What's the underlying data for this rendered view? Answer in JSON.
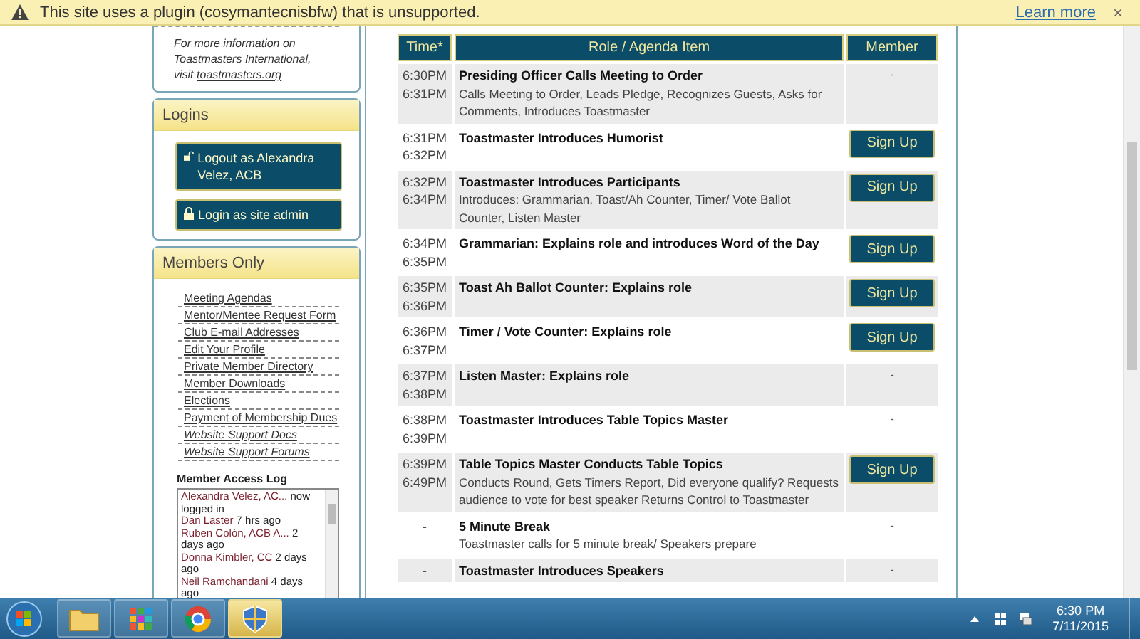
{
  "infobar": {
    "message": "This site uses a plugin (cosymantecnisbfw) that is unsupported.",
    "link": "Learn more",
    "close": "×"
  },
  "sidebar": {
    "info": {
      "text": "For more information on Toastmasters International, visit",
      "link": "toastmasters.org"
    },
    "logins": {
      "title": "Logins",
      "buttons": [
        {
          "label": "Logout as Alexandra Velez, ACB",
          "kind": "unlocked"
        },
        {
          "label": "Login as site admin",
          "kind": "locked"
        }
      ]
    },
    "members": {
      "title": "Members Only",
      "links": [
        {
          "label": "Meeting Agendas",
          "italic": false
        },
        {
          "label": "Mentor/Mentee Request Form",
          "italic": false
        },
        {
          "label": "Club E-mail Addresses",
          "italic": false
        },
        {
          "label": "Edit Your Profile",
          "italic": false
        },
        {
          "label": "Private Member Directory",
          "italic": false
        },
        {
          "label": "Member Downloads",
          "italic": false
        },
        {
          "label": "Elections",
          "italic": false
        },
        {
          "label": "Payment of Membership Dues",
          "italic": false
        },
        {
          "label": "Website Support Docs",
          "italic": true
        },
        {
          "label": "Website Support Forums",
          "italic": true
        }
      ],
      "log": {
        "title": "Member Access Log",
        "entries": [
          {
            "name": "Alexandra Velez, AC...",
            "text": "now logged in"
          },
          {
            "name": "Dan Laster",
            "text": "7 hrs ago"
          },
          {
            "name": "Ruben Colón, ACB A...",
            "text": "2 days ago"
          },
          {
            "name": "Donna Kimbler, CC",
            "text": "2 days ago"
          },
          {
            "name": "Neil Ramchandani",
            "text": "4 days ago"
          }
        ]
      }
    }
  },
  "table": {
    "columns": [
      "Time*",
      "Role / Agenda Item",
      "Member"
    ],
    "rows": [
      {
        "times": [
          "6:30PM",
          "6:31PM"
        ],
        "title": "Presiding Officer Calls Meeting to Order",
        "description": "Calls Meeting to Order, Leads Pledge, Recognizes Guests, Asks for Comments, Introduces Toastmaster",
        "member": {
          "kind": "dash",
          "label": "-"
        }
      },
      {
        "times": [
          "6:31PM",
          "6:32PM"
        ],
        "title": "Toastmaster Introduces Humorist",
        "member": {
          "kind": "signup",
          "label": "Sign Up"
        }
      },
      {
        "times": [
          "6:32PM",
          "6:34PM"
        ],
        "title": "Toastmaster Introduces Participants",
        "description": "Introduces: Grammarian, Toast/Ah Counter, Timer/ Vote Ballot Counter, Listen Master",
        "member": {
          "kind": "signup",
          "label": "Sign Up"
        }
      },
      {
        "times": [
          "6:34PM",
          "6:35PM"
        ],
        "title": "Grammarian: Explains role and introduces Word of the Day",
        "member": {
          "kind": "signup",
          "label": "Sign Up"
        }
      },
      {
        "times": [
          "6:35PM",
          "6:36PM"
        ],
        "title": "Toast Ah Ballot Counter: Explains role",
        "member": {
          "kind": "signup",
          "label": "Sign Up"
        }
      },
      {
        "times": [
          "6:36PM",
          "6:37PM"
        ],
        "title": "Timer / Vote Counter: Explains role",
        "member": {
          "kind": "signup",
          "label": "Sign Up"
        }
      },
      {
        "times": [
          "6:37PM",
          "6:38PM"
        ],
        "title": "Listen Master: Explains role",
        "member": {
          "kind": "dash",
          "label": "-"
        }
      },
      {
        "times": [
          "6:38PM",
          "6:39PM"
        ],
        "title": "Toastmaster Introduces Table Topics Master",
        "member": {
          "kind": "dash",
          "label": "-"
        }
      },
      {
        "times": [
          "6:39PM",
          "6:49PM"
        ],
        "title": "Table Topics Master Conducts Table Topics",
        "description": "Conducts Round, Gets Timers Report, Did everyone qualify? Requests audience to vote for best speaker Returns Control to Toastmaster",
        "member": {
          "kind": "signup",
          "label": "Sign Up"
        }
      },
      {
        "times": [
          "-"
        ],
        "title": "5 Minute Break",
        "description": "Toastmaster calls for 5 minute break/ Speakers prepare",
        "member": {
          "kind": "dash",
          "label": "-"
        }
      },
      {
        "times": [
          "-"
        ],
        "title": "Toastmaster Introduces Speakers",
        "member": {
          "kind": "dash",
          "label": "-"
        }
      }
    ]
  },
  "taskbar": {
    "apps": [
      {
        "kind": "explorer",
        "selected": false
      },
      {
        "kind": "apps",
        "selected": false
      },
      {
        "kind": "browser",
        "selected": false
      },
      {
        "kind": "shield",
        "selected": true
      }
    ],
    "time": "6:30 PM",
    "date": "7/11/2015"
  }
}
